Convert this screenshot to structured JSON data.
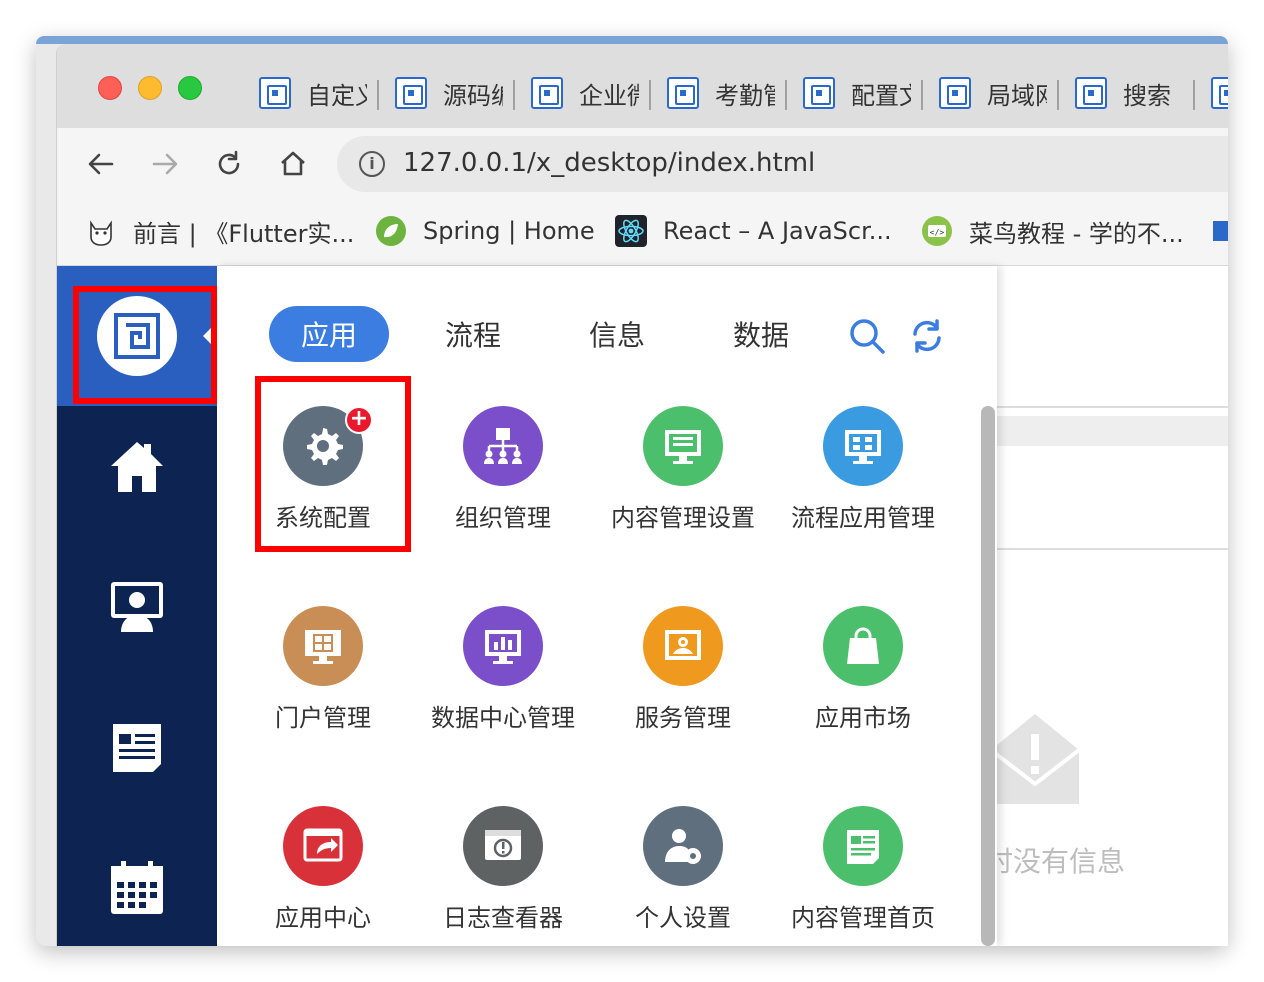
{
  "browser": {
    "tabs": [
      {
        "label": "自定义"
      },
      {
        "label": "源码编"
      },
      {
        "label": "企业微"
      },
      {
        "label": "考勤管"
      },
      {
        "label": "配置文"
      },
      {
        "label": "局域网"
      },
      {
        "label": "搜索"
      }
    ],
    "url": "127.0.0.1/x_desktop/index.html",
    "bookmarks": [
      {
        "label": "前言 | 《Flutter实...",
        "icon": "cat-icon"
      },
      {
        "label": "Spring | Home",
        "icon": "spring-leaf-icon"
      },
      {
        "label": "React – A JavaScr...",
        "icon": "react-atom-icon"
      },
      {
        "label": "菜鸟教程 - 学的不...",
        "icon": "runoob-icon"
      }
    ]
  },
  "menu": {
    "tabs": [
      {
        "label": "应用",
        "active": true
      },
      {
        "label": "流程",
        "active": false
      },
      {
        "label": "信息",
        "active": false
      },
      {
        "label": "数据",
        "active": false
      }
    ],
    "apps": [
      {
        "label": "系统配置",
        "color": "#5f6f7d",
        "icon": "gear-icon"
      },
      {
        "label": "组织管理",
        "color": "#7b4fc9",
        "icon": "org-chart-icon"
      },
      {
        "label": "内容管理设置",
        "color": "#4cbf6c",
        "icon": "monitor-doc-icon"
      },
      {
        "label": "流程应用管理",
        "color": "#3a9be0",
        "icon": "monitor-flow-icon"
      },
      {
        "label": "门户管理",
        "color": "#c98e55",
        "icon": "portal-grid-icon"
      },
      {
        "label": "数据中心管理",
        "color": "#7b4fc9",
        "icon": "bar-chart-icon"
      },
      {
        "label": "服务管理",
        "color": "#ef9a1f",
        "icon": "service-icon"
      },
      {
        "label": "应用市场",
        "color": "#4cbf6c",
        "icon": "shopping-bag-icon"
      },
      {
        "label": "应用中心",
        "color": "#d9313a",
        "icon": "share-window-icon"
      },
      {
        "label": "日志查看器",
        "color": "#5f6263",
        "icon": "log-viewer-icon"
      },
      {
        "label": "个人设置",
        "color": "#5f6f7d",
        "icon": "user-settings-icon"
      },
      {
        "label": "内容管理首页",
        "color": "#4cbf6c",
        "icon": "news-icon"
      }
    ]
  },
  "background": {
    "empty_message": "时没有信息"
  },
  "colors": {
    "sidebar": "#0d2452",
    "logo_bg": "#2a5fbf",
    "active_tab": "#3b7de0",
    "highlight_box": "#ff0000"
  }
}
